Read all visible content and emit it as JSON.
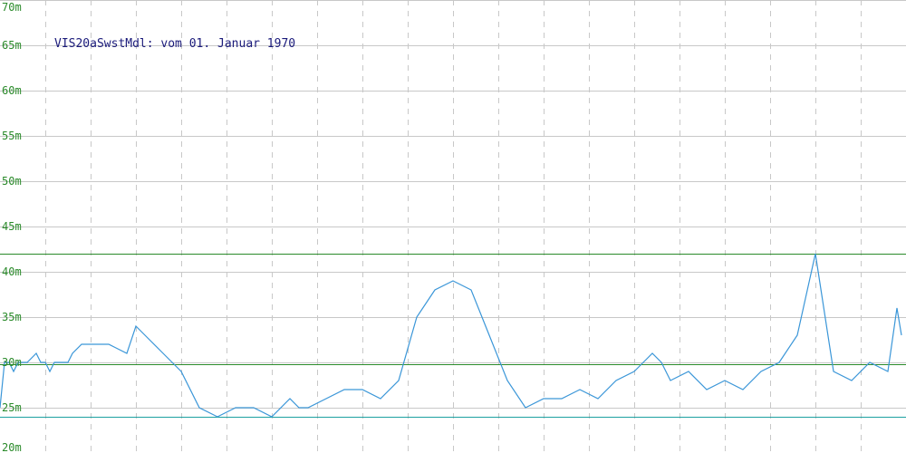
{
  "chart_data": {
    "type": "line",
    "title": "VIS20aSwstMdl: vom 01. Januar 1970",
    "xlabel": "",
    "ylabel": "",
    "ylim": [
      20,
      70
    ],
    "y_unit": "m",
    "y_ticks": [
      {
        "value": 20,
        "label": "20m"
      },
      {
        "value": 25,
        "label": "25m"
      },
      {
        "value": 30,
        "label": "30m"
      },
      {
        "value": 35,
        "label": "35m"
      },
      {
        "value": 40,
        "label": "40m"
      },
      {
        "value": 45,
        "label": "45m"
      },
      {
        "value": 50,
        "label": "50m"
      },
      {
        "value": 55,
        "label": "55m"
      },
      {
        "value": 60,
        "label": "60m"
      },
      {
        "value": 65,
        "label": "65m"
      },
      {
        "value": 70,
        "label": "70m"
      }
    ],
    "x_count": 20,
    "grid": true,
    "reference_lines": [
      {
        "value": 42,
        "color": "#2a8a2a"
      },
      {
        "value": 29.8,
        "color": "#2a8a2a"
      },
      {
        "value": 24,
        "color": "#1ca0a0"
      }
    ],
    "series": [
      {
        "color": "#3a96d8",
        "x": [
          0,
          0.1,
          0.2,
          0.3,
          0.4,
          0.6,
          0.8,
          0.9,
          1.0,
          1.1,
          1.2,
          1.3,
          1.5,
          1.6,
          1.8,
          2.0,
          2.4,
          2.8,
          3.0,
          3.2,
          3.6,
          4.0,
          4.4,
          4.8,
          5.2,
          5.6,
          6.0,
          6.4,
          6.6,
          6.8,
          7.2,
          7.6,
          8.0,
          8.4,
          8.8,
          9.2,
          9.6,
          10.0,
          10.4,
          10.8,
          11.2,
          11.6,
          12.0,
          12.4,
          12.8,
          13.2,
          13.6,
          14.0,
          14.2,
          14.4,
          14.6,
          14.8,
          15.2,
          15.6,
          16.0,
          16.4,
          16.8,
          17.2,
          17.6,
          18.0,
          18.4,
          18.8,
          19.2,
          19.6,
          19.8,
          19.9
        ],
        "values": [
          25,
          30,
          30,
          29,
          30,
          30,
          31,
          30,
          30,
          29,
          30,
          30,
          30,
          31,
          32,
          32,
          32,
          31,
          34,
          33,
          31,
          29,
          25,
          24,
          25,
          25,
          24,
          26,
          25,
          25,
          26,
          27,
          27,
          26,
          28,
          35,
          38,
          39,
          38,
          33,
          28,
          25,
          26,
          26,
          27,
          26,
          28,
          29,
          30,
          31,
          30,
          28,
          29,
          27,
          28,
          27,
          29,
          30,
          33,
          42,
          29,
          28,
          30,
          29,
          36,
          33
        ]
      }
    ]
  }
}
